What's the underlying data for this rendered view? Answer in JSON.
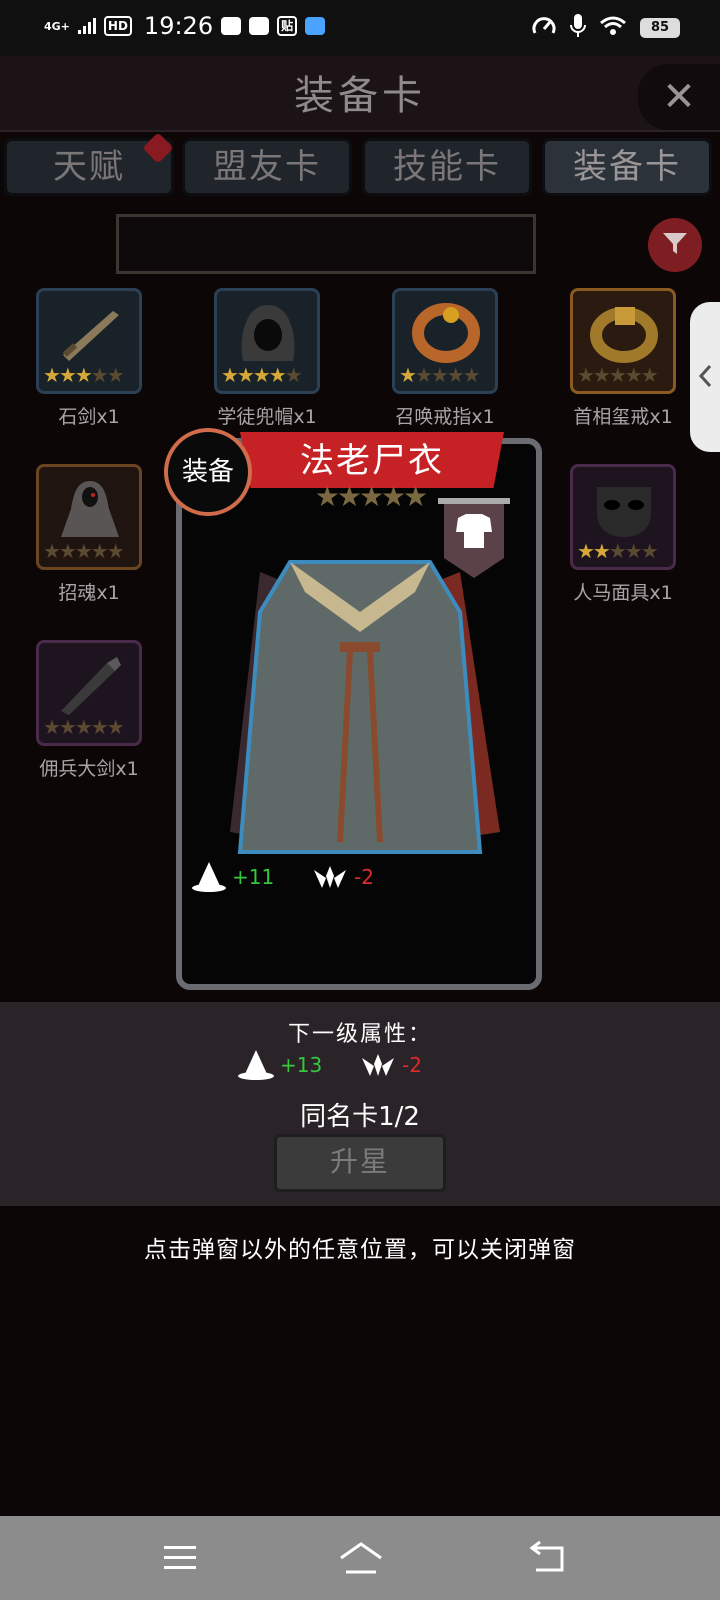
{
  "status_bar": {
    "network": "4G+",
    "hd": "HD",
    "time": "19:26",
    "app_badge": "贴",
    "battery": "85"
  },
  "header": {
    "title": "装备卡",
    "close_icon": "close-icon"
  },
  "tabs": [
    {
      "label": "天赋",
      "has_dot": true
    },
    {
      "label": "盟友卡"
    },
    {
      "label": "技能卡"
    },
    {
      "label": "装备卡",
      "active": true
    }
  ],
  "search": {
    "value": ""
  },
  "inventory": [
    {
      "label": "石剑x1",
      "stars": 3
    },
    {
      "label": "学徒兜帽x1",
      "stars": 4
    },
    {
      "label": "召唤戒指x1",
      "stars": 1
    },
    {
      "label": "首相玺戒x1",
      "stars": 0
    },
    {
      "label": "招魂x1",
      "stars": 0
    },
    {
      "label": "人马面具x1",
      "stars": 2
    },
    {
      "label": "佣兵大剑x1",
      "stars": 0
    }
  ],
  "card": {
    "type_badge": "装备",
    "name": "法老尸衣",
    "stars": 0,
    "slot_icon": "armor-icon",
    "stats": [
      {
        "icon": "wizard-hat-icon",
        "value": "+11",
        "color": "#35c73d"
      },
      {
        "icon": "wing-icon",
        "value": "-2",
        "color": "#e0292b"
      }
    ]
  },
  "next_level": {
    "title": "下一级属性：",
    "stats": [
      {
        "icon": "wizard-hat-icon",
        "value": "+13",
        "color": "#35c73d"
      },
      {
        "icon": "wing-icon",
        "value": "-2",
        "color": "#e0292b"
      }
    ]
  },
  "same_card": "同名卡1/2",
  "upgrade_label": "升星",
  "hint": "点击弹窗以外的任意位置，可以关闭弹窗"
}
